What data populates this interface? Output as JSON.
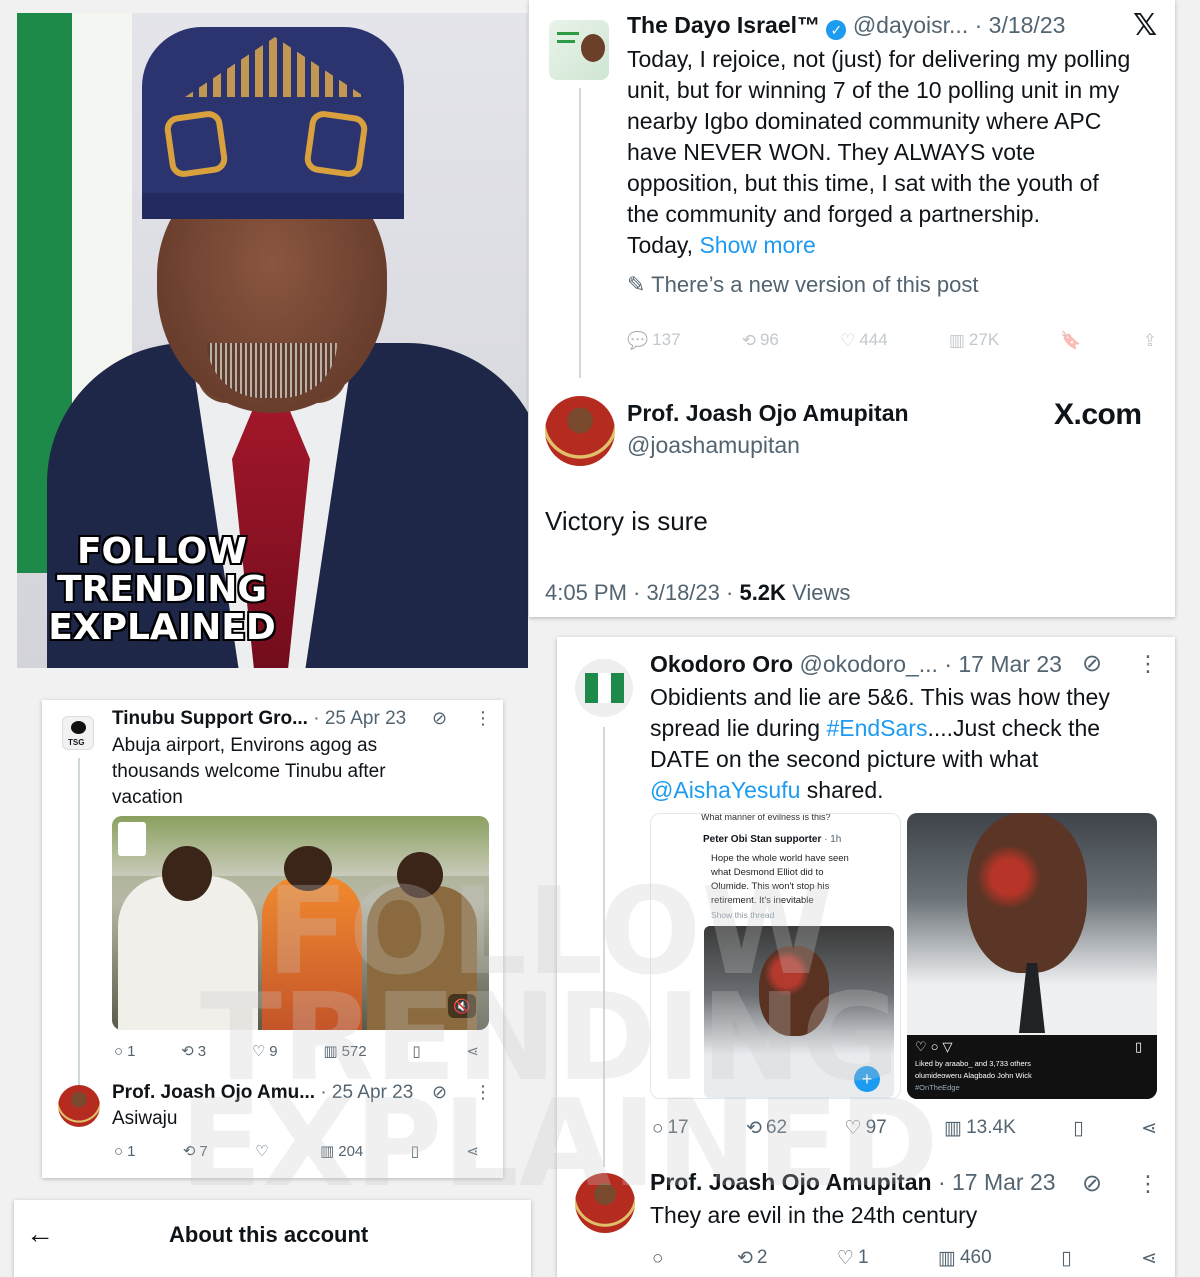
{
  "overlay": {
    "follow_lines": [
      "FOLLOW",
      "TRENDING",
      "EXPLAINED"
    ],
    "watermark_lines": [
      "FOLLOW",
      "TRENDING",
      "EXPLAINED"
    ]
  },
  "tweet_dayo": {
    "name": "The Dayo Israel™",
    "handle": "@dayoisr...",
    "date": "· 3/18/23",
    "text_lines": [
      "Today, I rejoice, not (just) for delivering my polling",
      "unit, but for winning 7 of the 10 polling unit in my",
      "nearby Igbo dominated community where APC",
      "have NEVER WON. They ALWAYS vote",
      "opposition, but this time, I sat with the youth of",
      "the community and forged a partnership.",
      "Today,"
    ],
    "show_more": "Show more",
    "new_version": "There’s a new version of this post",
    "replies": "137",
    "reposts": "96",
    "likes": "444",
    "views": "27K"
  },
  "reply_joash_main": {
    "name": "Prof. Joash Ojo Amupitan",
    "handle": "@joashamupitan",
    "site": "X.com",
    "text": "Victory is sure",
    "time": "4:05 PM · 3/18/23 ·",
    "views_count": "5.2K",
    "views_label": "Views"
  },
  "tweet_tinubu": {
    "name": "Tinubu Support Gro...",
    "date": "· 25 Apr 23",
    "text_lines": [
      "Abuja airport, Environs agog as",
      "thousands welcome Tinubu after",
      "vacation"
    ],
    "replies": "1",
    "reposts": "3",
    "likes": "9",
    "views": "572",
    "badge": "TSG"
  },
  "reply_tinubu": {
    "name": "Prof. Joash Ojo Amu...",
    "date": "· 25 Apr 23",
    "text": "Asiwaju",
    "replies": "1",
    "reposts": "7",
    "likes": "",
    "views": "204"
  },
  "about": {
    "title": "About this account"
  },
  "tweet_okodoro": {
    "name": "Okodoro Oro",
    "handle": "@okodoro_...",
    "date": "· 17 Mar 23",
    "line1": "Obidients and lie are 5&6. This was how they",
    "line2_pre": "spread lie during ",
    "hashtag": "#EndSars",
    "line2_post": "....Just check the",
    "line3": "DATE on the second picture with what",
    "mention": "@AishaYesufu",
    "line4_post": " shared.",
    "replies": "17",
    "reposts": "62",
    "likes": "97",
    "views": "13.4K"
  },
  "embedded": {
    "top_text": "What manner of evilness is this?",
    "poster": "Peter Obi Stan supporter",
    "poster_time": "· 1h",
    "text_lines": [
      "Hope the whole world have seen",
      "what Desmond Elliot did to",
      "Olumide. This won't stop his",
      "retirement. It's inevitable"
    ],
    "show_thread": "Show this thread",
    "liked_by": "Liked by araabo_ and 3,733 others",
    "caption": "olumideoweru Alagbado John Wick",
    "tag": "#OnTheEdge"
  },
  "reply_okodoro": {
    "name": "Prof. Joash Ojo Amupitan",
    "date": "· 17 Mar 23",
    "text": "They are evil in the 24th century",
    "replies": "",
    "reposts": "2",
    "likes": "1",
    "views": "460"
  },
  "colors": {
    "link": "#1d9bf0",
    "muted": "#536471",
    "verified": "#1d9bf0",
    "suit": "#1f2748",
    "cap": "#2c3470"
  }
}
